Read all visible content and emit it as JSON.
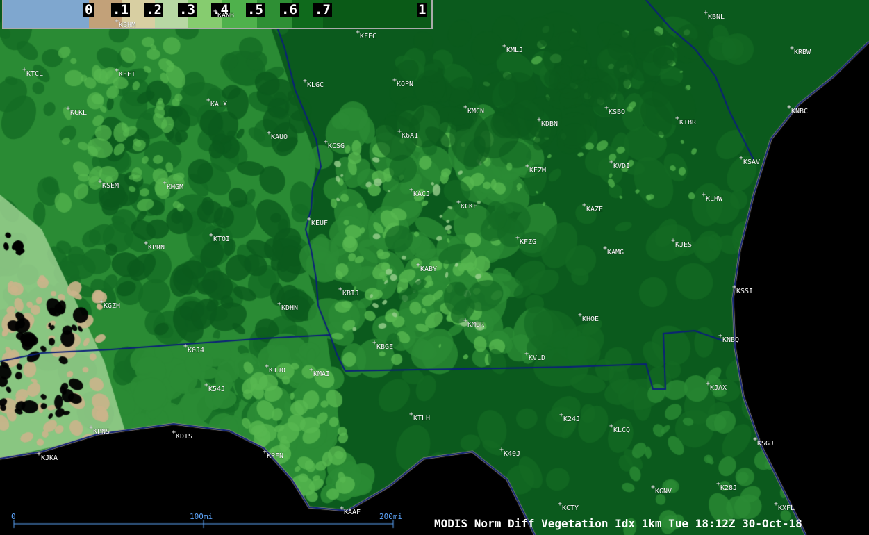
{
  "legend": {
    "ticks": [
      "0",
      ".1",
      ".2",
      ".3",
      ".4",
      ".5",
      ".6",
      ".7",
      "1"
    ],
    "colors": [
      "#7fa7cf",
      "#c2a179",
      "#d8cfa2",
      "#b7d8a4",
      "#86cc6f",
      "#4fb14c",
      "#2e8f34",
      "#0f6a1c",
      "#0a5a17"
    ]
  },
  "map_colors": {
    "water": "#000000",
    "forest_dark": "#0b5a1d",
    "forest": "#146b24",
    "medium": "#2a8b34",
    "light": "#57b850",
    "pale": "#9ad08f",
    "sand": "#cbb48b",
    "boundary": "#0b1f7a",
    "scale": "#5fa8ff"
  },
  "stations": [
    {
      "id": "KBHM"
    },
    {
      "id": "KANB"
    },
    {
      "id": "KFFC"
    },
    {
      "id": "KBNL"
    },
    {
      "id": "KMLJ"
    },
    {
      "id": "KRBW"
    },
    {
      "id": "KTCL"
    },
    {
      "id": "KEET"
    },
    {
      "id": "KLGC"
    },
    {
      "id": "KOPN"
    },
    {
      "id": "KALX"
    },
    {
      "id": "KCKL"
    },
    {
      "id": "KMCN"
    },
    {
      "id": "KSBO"
    },
    {
      "id": "KDBN"
    },
    {
      "id": "KTBR"
    },
    {
      "id": "KNBC"
    },
    {
      "id": "KAUO"
    },
    {
      "id": "KCSG"
    },
    {
      "id": "K6A1"
    },
    {
      "id": "KEZM"
    },
    {
      "id": "KVDI"
    },
    {
      "id": "KSAV"
    },
    {
      "id": "KSEM"
    },
    {
      "id": "KMGM"
    },
    {
      "id": "KACJ"
    },
    {
      "id": "KCKF"
    },
    {
      "id": "KAZE"
    },
    {
      "id": "KLHW"
    },
    {
      "id": "KEUF"
    },
    {
      "id": "KTOI"
    },
    {
      "id": "KFZG"
    },
    {
      "id": "KJES"
    },
    {
      "id": "KPRN"
    },
    {
      "id": "KAMG"
    },
    {
      "id": "KABY"
    },
    {
      "id": "KBIJ"
    },
    {
      "id": "KSSI"
    },
    {
      "id": "KGZH"
    },
    {
      "id": "KDHN"
    },
    {
      "id": "KMGR"
    },
    {
      "id": "KHOE"
    },
    {
      "id": "KBGE"
    },
    {
      "id": "KNBQ"
    },
    {
      "id": "K0J4"
    },
    {
      "id": "KVLD"
    },
    {
      "id": "K1J0"
    },
    {
      "id": "KMAI"
    },
    {
      "id": "KJAX"
    },
    {
      "id": "K54J"
    },
    {
      "id": "KTLH"
    },
    {
      "id": "K24J"
    },
    {
      "id": "KLCQ"
    },
    {
      "id": "KPNS"
    },
    {
      "id": "KDTS"
    },
    {
      "id": "KSGJ"
    },
    {
      "id": "K40J"
    },
    {
      "id": "KPFN"
    },
    {
      "id": "KJKA"
    },
    {
      "id": "KGNV"
    },
    {
      "id": "K28J"
    },
    {
      "id": "KAAF"
    },
    {
      "id": "KCTY"
    },
    {
      "id": "KXFL"
    }
  ],
  "scale_bar": {
    "labels": [
      "0",
      "100mi",
      "200mi"
    ]
  },
  "caption": "MODIS Norm Diff Vegetation Idx 1km  Tue 18:12Z 30-Oct-18"
}
